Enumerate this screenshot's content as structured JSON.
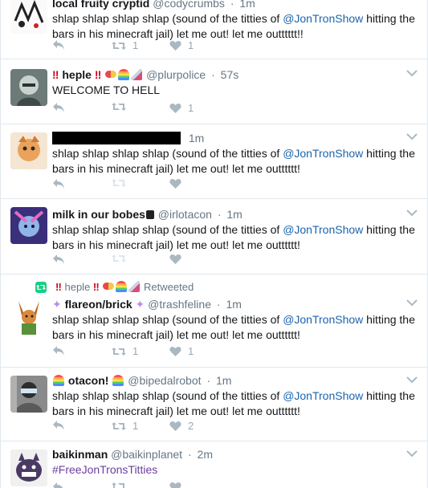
{
  "tweets": [
    {
      "fullname": "local fruity cryptid",
      "username": "@codycrumbs",
      "time": "1m",
      "text_parts": [
        "shlap shlap shlap shlap (sound of the titties of ",
        "@JonTronShow",
        " hitting the bars in his minecraft jail) let me out! let me outttttt!!"
      ],
      "retweets": "1",
      "likes": "1",
      "avatar_color": "#f2f2f2"
    },
    {
      "fullname": "heple",
      "username": "@plurpolice",
      "time": "57s",
      "text": "WELCOME TO HELL",
      "retweets": "",
      "likes": "1",
      "avatar_color": "#7d8a86"
    },
    {
      "fullname": "",
      "username": "",
      "time": "1m",
      "text_parts": [
        "shlap shlap shlap shlap (sound of the titties of ",
        "@JonTronShow",
        " hitting the bars in his minecraft jail) let me out! let me outttttt!"
      ],
      "retweets": "",
      "likes": "",
      "avatar_color": "#f0c9a0"
    },
    {
      "fullname": "milk in our bobes",
      "username": "@irlotacon",
      "time": "1m",
      "text_parts": [
        "shlap shlap shlap shlap (sound of the titties of ",
        "@JonTronShow",
        " hitting the bars in his minecraft jail) let me out! let me outttttt!"
      ],
      "retweets": "",
      "likes": "",
      "avatar_color": "#4a3d8f"
    },
    {
      "retweeted_by": "heple",
      "retweeted_label": "Retweeted",
      "fullname": "flareon/brick",
      "username": "@trashfeline",
      "time": "1m",
      "text_parts": [
        "shlap shlap shlap shlap (sound of the titties of ",
        "@JonTronShow",
        " hitting the bars in his minecraft jail) let me out! let me outttttt!"
      ],
      "retweets": "1",
      "likes": "1",
      "avatar_color": "#c8e6c9"
    },
    {
      "fullname": "otacon!",
      "username": "@bipedalrobot",
      "time": "1m",
      "text_parts": [
        "shlap shlap shlap shlap (sound of the titties of ",
        "@JonTronShow",
        " hitting the bars in his minecraft jail) let me out! let me outttttt!"
      ],
      "retweets": "1",
      "likes": "2",
      "avatar_color": "#9e9e9e"
    },
    {
      "fullname": "baikinman",
      "username": "@baikinplanet",
      "time": "2m",
      "text": "#FreeJonTronsTitties",
      "retweets": "",
      "likes": "",
      "avatar_color": "#5a4a6e"
    }
  ],
  "colors": {
    "mention": "#1b64ad",
    "hashtag": "#6b3fa0",
    "retweet_badge": "#19cf86",
    "action_gray": "#aab8c2",
    "divider": "#e1e8ed"
  },
  "icons": [
    "reply-icon",
    "retweet-icon",
    "like-icon",
    "caret-down-icon"
  ]
}
